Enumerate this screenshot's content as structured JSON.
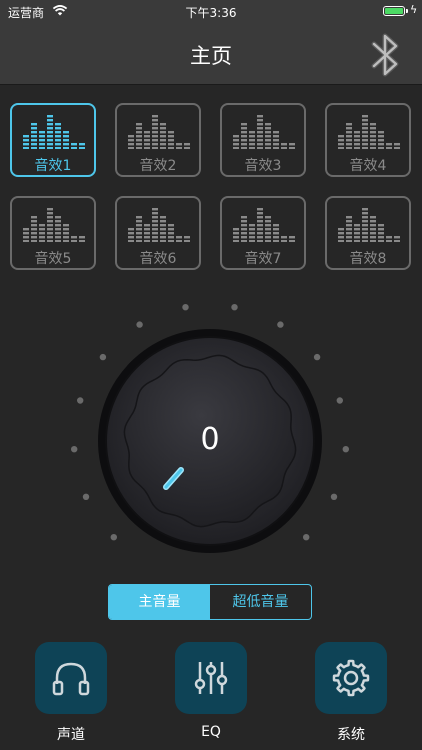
{
  "status_bar": {
    "carrier": "运营商",
    "time": "下午3:36",
    "battery_level": 1.0
  },
  "header": {
    "title": "主页",
    "bluetooth_icon": "bluetooth-icon"
  },
  "effects": {
    "selected_index": 0,
    "items": [
      {
        "label": "音效1"
      },
      {
        "label": "音效2"
      },
      {
        "label": "音效3"
      },
      {
        "label": "音效4"
      },
      {
        "label": "音效5"
      },
      {
        "label": "音效6"
      },
      {
        "label": "音效7"
      },
      {
        "label": "音效8"
      }
    ]
  },
  "knob": {
    "value": "0",
    "dot_count": 14
  },
  "volume_toggle": {
    "main_label": "主音量",
    "sub_label": "超低音量",
    "selected": "main"
  },
  "bottom_bar": {
    "items": [
      {
        "label": "声道",
        "icon": "headphones-icon"
      },
      {
        "label": "EQ",
        "icon": "equalizer-icon"
      },
      {
        "label": "系统",
        "icon": "gear-icon"
      }
    ]
  },
  "colors": {
    "accent": "#4ec6ea",
    "background": "#262626",
    "header": "#3a3a3a",
    "tab_icon_bg": "#0e4356"
  }
}
